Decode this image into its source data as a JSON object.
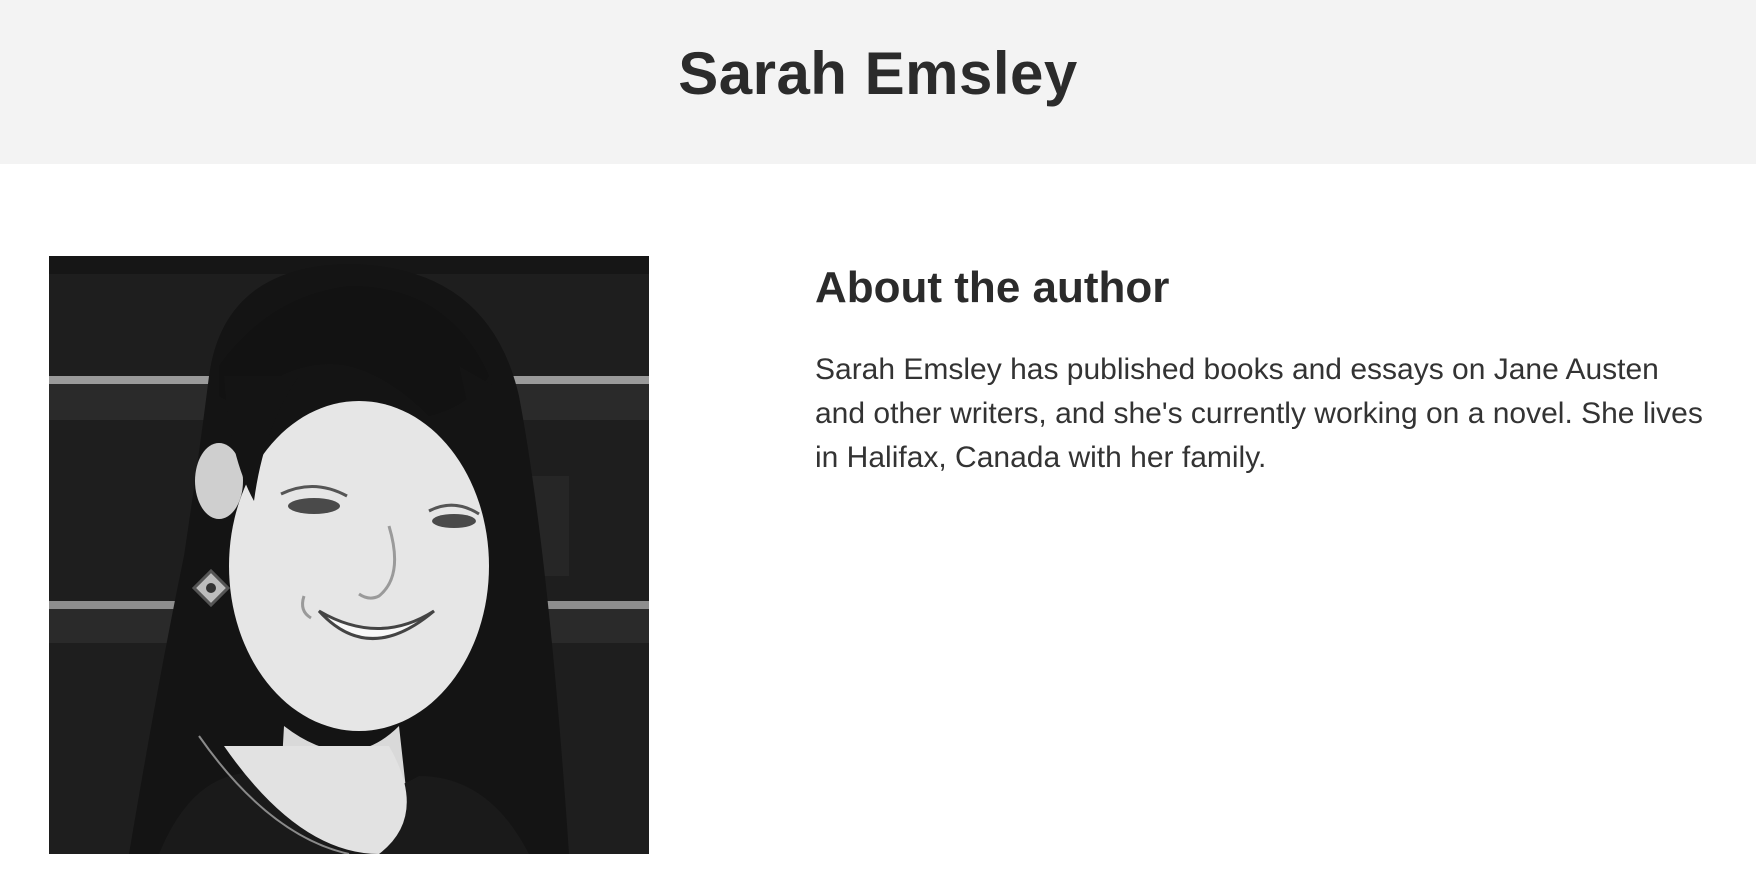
{
  "header": {
    "author_name": "Sarah Emsley"
  },
  "author_photo": {
    "alt": "Sarah Emsley"
  },
  "about": {
    "heading": "About the author",
    "bio": "Sarah Emsley has published books and essays on Jane Austen and other writers, and she's currently working on a novel. She lives in Halifax, Canada with her family."
  },
  "colors": {
    "header_background": "#f3f3f3",
    "text": "#2b2b2b"
  }
}
